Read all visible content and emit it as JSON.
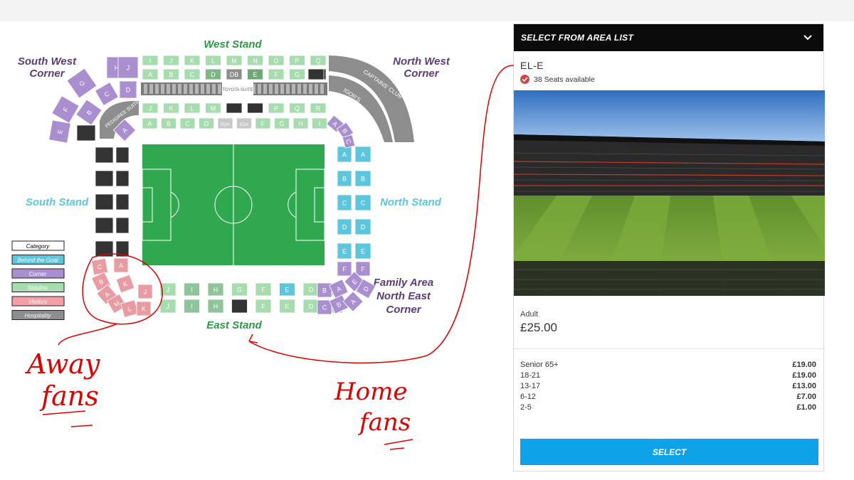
{
  "stadium": {
    "stands": {
      "west": "West Stand",
      "east": "East Stand",
      "south": "South Stand",
      "north": "North Stand",
      "south_west_1": "South West",
      "south_west_2": "Corner",
      "north_west_1": "North West",
      "north_west_2": "Corner",
      "family_1": "Family Area",
      "family_2": "North East",
      "family_3": "Corner"
    },
    "features": {
      "toyota_suite": "TOYOTA SUITE",
      "pedigree_suite": "PEDIGREE SUITE",
      "captains_club": "CAPTAINS' CLUB",
      "igors": "IGOR'S"
    },
    "west_row1": [
      "I",
      "J",
      "K",
      "L",
      "M",
      "N",
      "O",
      "P",
      "Q"
    ],
    "west_row2": [
      "A",
      "B",
      "C",
      "D",
      "DB",
      "E",
      "F",
      "G",
      ""
    ],
    "west_row3": [
      "J",
      "K",
      "L",
      "M",
      "",
      "",
      "P",
      "Q",
      "R"
    ],
    "west_row4": [
      "A",
      "B",
      "C",
      "D",
      "EDH",
      "EDA",
      "F",
      "G",
      "H",
      "I"
    ],
    "north_col1": [
      "A",
      "B",
      "C",
      "D",
      "E"
    ],
    "north_col2": [
      "A",
      "B",
      "C",
      "D",
      "E"
    ],
    "east_row1": [
      "J",
      "I",
      "H",
      "G",
      "F",
      "E",
      "D",
      "C"
    ],
    "east_row2": [
      "J",
      "I",
      "H",
      "",
      "F",
      "E",
      "D",
      "C"
    ],
    "nw_corner_upper": [
      "H",
      "J",
      "G",
      "D",
      "C",
      "B",
      "A"
    ],
    "sw_corner_lower": [
      "F",
      "E",
      "B",
      "A"
    ],
    "away_upper": [
      "C",
      "A",
      "B",
      "K",
      "J"
    ],
    "away_lower": [
      "A",
      "M",
      "L",
      "K"
    ],
    "ne_upper": [
      "F",
      "F",
      "A",
      "E",
      "D"
    ],
    "ne_lower": [
      "B",
      "A",
      "C",
      "B",
      "A"
    ],
    "legend": [
      {
        "label": "Category",
        "color": "#ffffff"
      },
      {
        "label": "Behind the Goal",
        "color": "#5bc6dc"
      },
      {
        "label": "Corner",
        "color": "#a98fd0"
      },
      {
        "label": "Sideline",
        "color": "#a6dcae"
      },
      {
        "label": "Visitors",
        "color": "#f2a0a6"
      },
      {
        "label": "Hospitality",
        "color": "#8d8d8d"
      }
    ],
    "colors": {
      "pitch": "#2fa84f",
      "sideline": "#a6dcae",
      "corner": "#a98fd0",
      "behind_goal": "#5bc6dc",
      "visitors": "#e89ca2",
      "hospitality": "#8d8d8d",
      "dark_block": "#333333",
      "title_green": "#2e9a45",
      "title_purple": "#5b3c7c",
      "title_blue": "#5bc6dc"
    }
  },
  "annotations": {
    "away_line1": "Away",
    "away_line2": "fans",
    "home_line1": "Home",
    "home_line2": "fans",
    "ink_color": "#e00000"
  },
  "panel": {
    "header": "SELECT FROM AREA LIST",
    "area_name": "EL-E",
    "availability": "38 Seats available",
    "adult_label": "Adult",
    "adult_price": "£25.00",
    "concessions": [
      {
        "label": "Senior 65+",
        "price": "£19.00"
      },
      {
        "label": "18-21",
        "price": "£19.00"
      },
      {
        "label": "13-17",
        "price": "£13.00"
      },
      {
        "label": "6-12",
        "price": "£7.00"
      },
      {
        "label": "2-5",
        "price": "£1.00"
      }
    ],
    "select_label": "SELECT",
    "accent": "#0ea2e8"
  }
}
